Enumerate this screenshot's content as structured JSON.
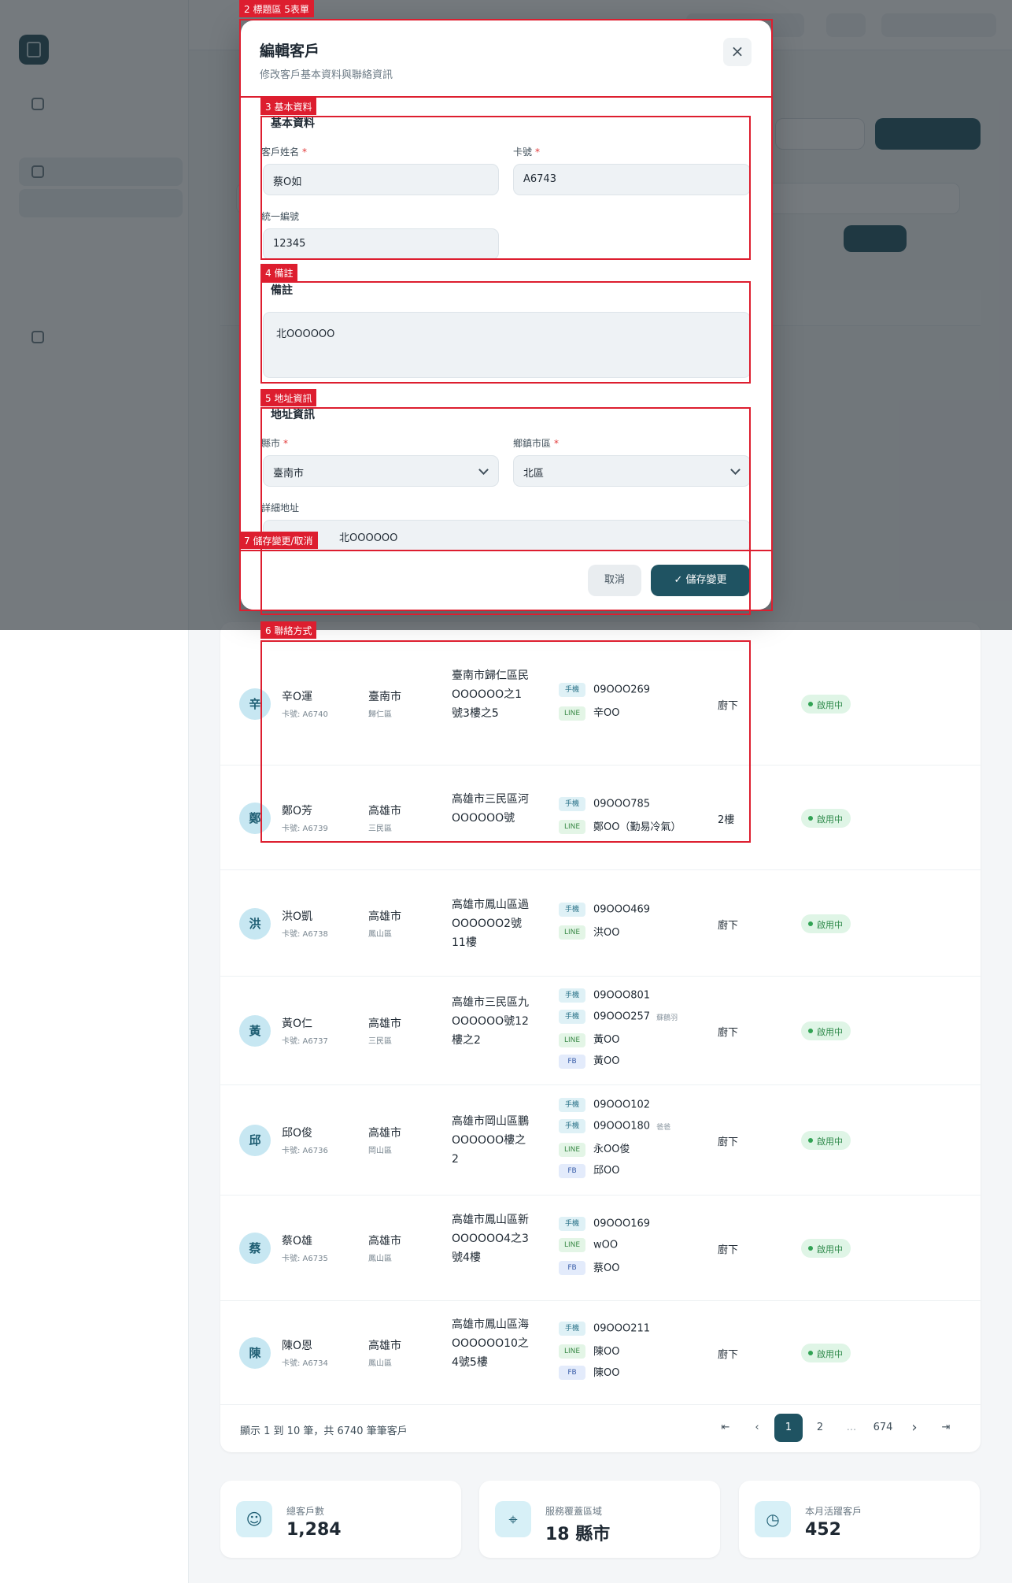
{
  "modal": {
    "title": "編輯客戶",
    "subtitle": "修改客戶基本資料與聯絡資訊",
    "close_icon": "close-icon",
    "basic_section": "基本資料",
    "name_label": "客戶姓名",
    "name_value": "蔡O如",
    "card_label": "卡號",
    "card_value": "A6743",
    "taxid_label": "統一編號",
    "taxid_value": "12345",
    "notes_section": "備註",
    "notes_label": "備註",
    "notes_value": "北OOOOOO",
    "address_section": "地址資訊",
    "county_label": "縣市",
    "county_value": "臺南市",
    "district_label": "鄉鎮市區",
    "district_value": "北區",
    "detail_label": "詳細地址",
    "detail_value": "北OOOOOO",
    "required_mark": "*",
    "cancel_label": "取消",
    "save_label": "儲存變更",
    "save_icon": "check-icon"
  },
  "annotations": [
    {
      "label": "2 標題區 5表單"
    },
    {
      "label": "3 基本資料"
    },
    {
      "label": "4 備註"
    },
    {
      "label": "5 地址資訊"
    },
    {
      "label": "7 儲存變更/取消"
    },
    {
      "label": "6 聯絡方式"
    }
  ],
  "table": {
    "rows": [
      {
        "avatar": "辛",
        "name": "辛O運",
        "card": "卡號: A6740",
        "city": "臺南市",
        "district": "歸仁區",
        "address": "臺南市歸仁區民OOOOOO之1號3樓之5",
        "contacts": [
          {
            "type": "手機",
            "value": "09OOO269",
            "note": ""
          },
          {
            "type": "LINE",
            "value": "辛OO",
            "note": ""
          }
        ],
        "floor": "廚下",
        "status": "啟用中"
      },
      {
        "avatar": "鄭",
        "name": "鄭O芳",
        "card": "卡號: A6739",
        "city": "高雄市",
        "district": "三民區",
        "address": "高雄市三民區河OOOOOO號",
        "contacts": [
          {
            "type": "手機",
            "value": "09OOO785",
            "note": ""
          },
          {
            "type": "LINE",
            "value": "鄭OO（勤易冷氣）",
            "note": ""
          }
        ],
        "floor": "2樓",
        "status": "啟用中"
      },
      {
        "avatar": "洪",
        "name": "洪O凱",
        "card": "卡號: A6738",
        "city": "高雄市",
        "district": "鳳山區",
        "address": "高雄市鳳山區過OOOOOO2號11樓",
        "contacts": [
          {
            "type": "手機",
            "value": "09OOO469",
            "note": ""
          },
          {
            "type": "LINE",
            "value": "洪OO",
            "note": ""
          }
        ],
        "floor": "廚下",
        "status": "啟用中"
      },
      {
        "avatar": "黃",
        "name": "黃O仁",
        "card": "卡號: A6737",
        "city": "高雄市",
        "district": "三民區",
        "address": "高雄市三民區九OOOOOO號12樓之2",
        "contacts": [
          {
            "type": "手機",
            "value": "09OOO801",
            "note": ""
          },
          {
            "type": "手機",
            "value": "09OOO257",
            "note": "蘇鶴羽"
          },
          {
            "type": "LINE",
            "value": "黃OO",
            "note": ""
          },
          {
            "type": "FB",
            "value": "黃OO",
            "note": ""
          }
        ],
        "floor": "廚下",
        "status": "啟用中"
      },
      {
        "avatar": "邱",
        "name": "邱O俊",
        "card": "卡號: A6736",
        "city": "高雄市",
        "district": "岡山區",
        "address": "高雄市岡山區鵬OOOOOO樓之2",
        "contacts": [
          {
            "type": "手機",
            "value": "09OOO102",
            "note": ""
          },
          {
            "type": "手機",
            "value": "09OOO180",
            "note": "爸爸"
          },
          {
            "type": "LINE",
            "value": "永OO俊",
            "note": ""
          },
          {
            "type": "FB",
            "value": "邱OO",
            "note": ""
          }
        ],
        "floor": "廚下",
        "status": "啟用中"
      },
      {
        "avatar": "蔡",
        "name": "蔡O雄",
        "card": "卡號: A6735",
        "city": "高雄市",
        "district": "鳳山區",
        "address": "高雄市鳳山區新OOOOOO4之3號4樓",
        "contacts": [
          {
            "type": "手機",
            "value": "09OOO169",
            "note": ""
          },
          {
            "type": "LINE",
            "value": "wOO",
            "note": ""
          },
          {
            "type": "FB",
            "value": "蔡OO",
            "note": ""
          }
        ],
        "floor": "廚下",
        "status": "啟用中"
      },
      {
        "avatar": "陳",
        "name": "陳O恩",
        "card": "卡號: A6734",
        "city": "高雄市",
        "district": "鳳山區",
        "address": "高雄市鳳山區海OOOOOO10之4號5樓",
        "contacts": [
          {
            "type": "手機",
            "value": "09OOO211",
            "note": ""
          },
          {
            "type": "LINE",
            "value": "陳OO",
            "note": ""
          },
          {
            "type": "FB",
            "value": "陳OO",
            "note": ""
          }
        ],
        "floor": "廚下",
        "status": "啟用中"
      }
    ]
  },
  "pagination": {
    "info": "顯示 1 到 10 筆，共 6740 筆筆客戶",
    "pages": [
      "1",
      "2",
      "...",
      "674"
    ],
    "first_icon": "first-page-icon",
    "prev_icon": "chevron-left-icon",
    "next_icon": "chevron-right-icon",
    "last_icon": "last-page-icon"
  },
  "stats": [
    {
      "label": "總客戶數",
      "value": "1,284",
      "icon": "users-icon"
    },
    {
      "label": "服務覆蓋區域",
      "value": "18 縣市",
      "icon": "map-pin-icon"
    },
    {
      "label": "本月活躍客戶",
      "value": "452",
      "icon": "clock-icon"
    }
  ],
  "colors": {
    "accent": "#1f5362",
    "annotation": "#dd1e2f",
    "status": "#31a354"
  }
}
